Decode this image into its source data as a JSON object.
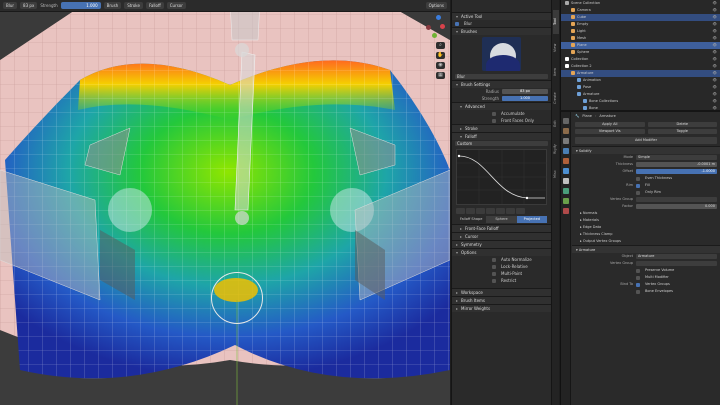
{
  "topbar": {
    "mode": "Blur",
    "radius": "83 px",
    "strength": "Strength",
    "strength_value": "1.000",
    "menus": [
      "Brush",
      "Stroke",
      "Falloff",
      "Cursor"
    ],
    "options": "Options"
  },
  "npanel": {
    "active_tool_title": "Active Tool",
    "tool_name": "Blur",
    "brushes_title": "Brushes",
    "brush_name": "Blur",
    "brush_settings_title": "Brush Settings",
    "radius_label": "Radius",
    "radius_value": "83 px",
    "strength_label": "Strength",
    "strength_value": "1.000",
    "strength_fraction": 1.0,
    "advanced_title": "Advanced",
    "accumulate": "Accumulate",
    "front_faces_only": "Front Faces Only",
    "stroke_title": "Stroke",
    "falloff_title": "Falloff",
    "falloff_preset": "Custom",
    "falloff_shape_label": "Falloff Shape",
    "sphere_label": "Sphere",
    "projected_label": "Projected",
    "front_face_falloff": "Front-Face Falloff",
    "cursor_title": "Cursor",
    "symmetry_title": "Symmetry",
    "options_title": "Options",
    "auto_normalize": "Auto Normalize",
    "lock_relative": "Lock-Relative",
    "multi_paint": "Multi-Paint",
    "restrict": "Restrict",
    "workspace_title": "Workspace",
    "brush_names_title": "Brush Items",
    "mirror_weights_title": "Mirror Weights"
  },
  "ntabs": [
    "Tool",
    "View",
    "Item",
    "Create",
    "Edit",
    "Rigify",
    "Misc"
  ],
  "outliner": {
    "rows": [
      {
        "label": "Scene Collection",
        "indent": 0,
        "color": "#aaaaaa",
        "state": ""
      },
      {
        "label": "Camera",
        "indent": 1,
        "color": "#e3a456",
        "state": ""
      },
      {
        "label": "Cube",
        "indent": 1,
        "color": "#e3a456",
        "state": "sel"
      },
      {
        "label": "Empty",
        "indent": 1,
        "color": "#e3a456",
        "state": ""
      },
      {
        "label": "Light",
        "indent": 1,
        "color": "#e3a456",
        "state": ""
      },
      {
        "label": "Mesh",
        "indent": 1,
        "color": "#e3a456",
        "state": ""
      },
      {
        "label": "Plane",
        "indent": 1,
        "color": "#e3a456",
        "state": "act"
      },
      {
        "label": "Sphere",
        "indent": 1,
        "color": "#e3a456",
        "state": ""
      },
      {
        "label": "Collection",
        "indent": 0,
        "color": "#ffffff",
        "state": ""
      },
      {
        "label": "Collection 2",
        "indent": 0,
        "color": "#ffffff",
        "state": ""
      },
      {
        "label": "Armature",
        "indent": 1,
        "color": "#e3a456",
        "state": "sel"
      },
      {
        "label": "Animation",
        "indent": 2,
        "color": "#6ea0d8",
        "state": ""
      },
      {
        "label": "Pose",
        "indent": 2,
        "color": "#6ea0d8",
        "state": ""
      },
      {
        "label": "Armature",
        "indent": 2,
        "color": "#6ea0d8",
        "state": ""
      },
      {
        "label": "Bone Collections",
        "indent": 3,
        "color": "#6ea0d8",
        "state": ""
      },
      {
        "label": "Bone",
        "indent": 3,
        "color": "#6ea0d8",
        "state": ""
      }
    ]
  },
  "props": {
    "object_name": "Plane",
    "modifier_target": "Armature",
    "apply_label": "Apply All",
    "viewport_label": "Viewport Vis",
    "delete_label": "Delete",
    "toggle_label": "Toggle",
    "add_modifier": "Add Modifier",
    "mod1_name": "Solidify",
    "mode_label": "Mode",
    "mode_value": "Simple",
    "thickness_label": "Thickness",
    "thickness_value": "-0.0001 m",
    "offset_label": "Offset",
    "offset_value": "-1.0000",
    "even_thickness": "Even Thickness",
    "rim_label": "Rim",
    "rim_fill": "Fill",
    "only_rim": "Only Rim",
    "vertex_group_label": "Vertex Group",
    "factor_label": "Factor",
    "factor_value": "0.000",
    "sub_normals": "Normals",
    "sub_materials": "Materials",
    "sub_edge_data": "Edge Data",
    "sub_thickness_clamp": "Thickness Clamp",
    "sub_output_vgroups": "Output Vertex Groups",
    "mod2_name": "Armature",
    "object_label": "Object",
    "object_value": "Armature",
    "vgroup_label": "Vertex Group",
    "preserve_volume": "Preserve Volume",
    "multi_modifier": "Multi Modifier",
    "bind_to_label": "Bind To",
    "bind_vgroups": "Vertex Groups",
    "bind_envelopes": "Bone Envelopes"
  },
  "colors": {
    "accent": "#4772b3",
    "panel_bg": "#2a2a2a",
    "viewport_bg": "#3a3a3a"
  }
}
